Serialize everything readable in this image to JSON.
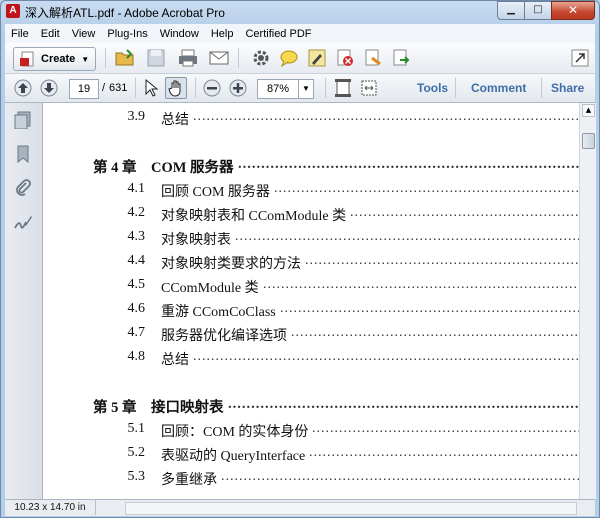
{
  "window": {
    "title": "深入解析ATL.pdf - Adobe Acrobat Pro",
    "app_icon_glyph": "A"
  },
  "menu": [
    "File",
    "Edit",
    "View",
    "Plug-Ins",
    "Window",
    "Help",
    "Certified PDF"
  ],
  "toolbar": {
    "create_label": "Create"
  },
  "nav": {
    "current_page": "19",
    "page_sep": "/",
    "total_pages": "631",
    "zoom": "87%"
  },
  "panels": {
    "tools": "Tools",
    "comment": "Comment",
    "share": "Share"
  },
  "status": {
    "page_size": "10.23 x 14.70 in"
  },
  "toc": [
    {
      "num": "3.9",
      "text": "总结",
      "chapter": false
    },
    {
      "num": "",
      "text": "第 4 章　COM 服务器",
      "chapter": true
    },
    {
      "num": "4.1",
      "text": "回顾 COM 服务器",
      "chapter": false
    },
    {
      "num": "4.2",
      "text": "对象映射表和 CComModule 类",
      "chapter": false
    },
    {
      "num": "4.3",
      "text": "对象映射表",
      "chapter": false
    },
    {
      "num": "4.4",
      "text": "对象映射类要求的方法",
      "chapter": false
    },
    {
      "num": "4.5",
      "text": "CComModule 类",
      "chapter": false
    },
    {
      "num": "4.6",
      "text": "重游 CComCoClass",
      "chapter": false
    },
    {
      "num": "4.7",
      "text": "服务器优化编译选项",
      "chapter": false
    },
    {
      "num": "4.8",
      "text": "总结",
      "chapter": false
    },
    {
      "num": "",
      "text": "第 5 章　接口映射表",
      "chapter": true
    },
    {
      "num": "5.1",
      "text": "回顾：COM 的实体身份",
      "chapter": false
    },
    {
      "num": "5.2",
      "text": "表驱动的 QueryInterface",
      "chapter": false
    },
    {
      "num": "5.3",
      "text": "多重继承",
      "chapter": false
    }
  ]
}
